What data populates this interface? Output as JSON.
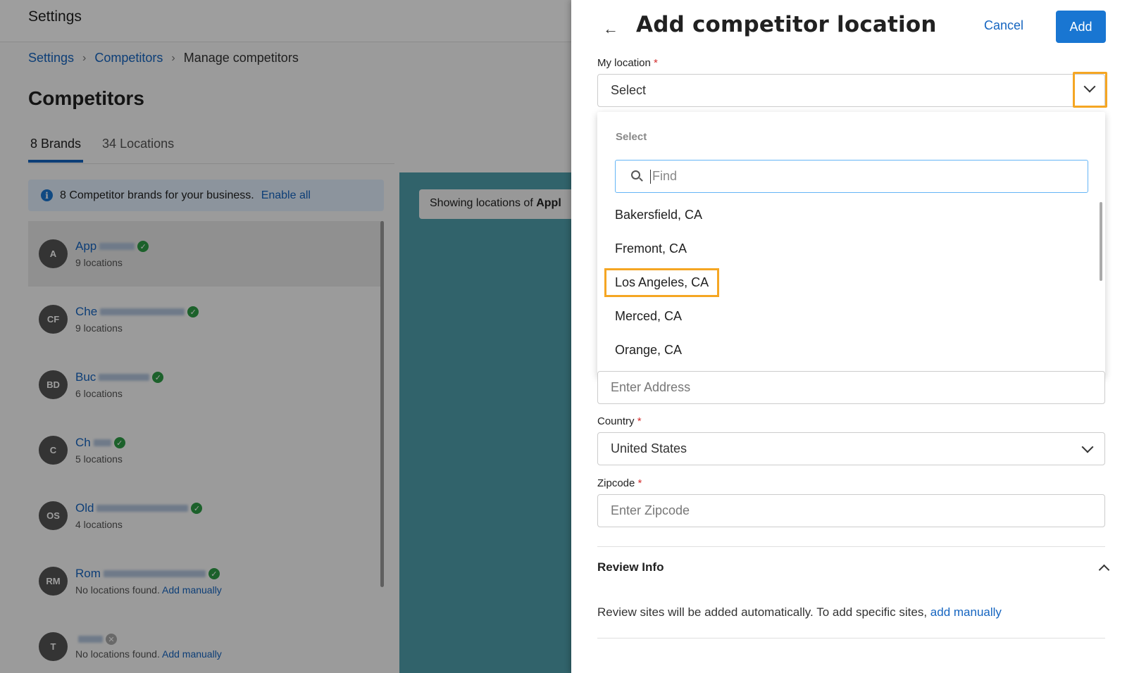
{
  "app": {
    "title": "Settings"
  },
  "breadcrumb": [
    {
      "label": "Settings"
    },
    {
      "label": "Competitors"
    },
    {
      "label": "Manage competitors"
    }
  ],
  "page": {
    "title": "Competitors"
  },
  "tabs": [
    {
      "label": "8 Brands"
    },
    {
      "label": "34 Locations"
    }
  ],
  "banner": {
    "text": "8 Competitor brands for your business.",
    "link": "Enable all"
  },
  "brands": [
    {
      "initials": "A",
      "name": "App",
      "sub": "9 locations",
      "verified": true
    },
    {
      "initials": "CF",
      "name": "Che",
      "sub": "9 locations",
      "verified": true
    },
    {
      "initials": "BD",
      "name": "Buc",
      "sub": "6 locations",
      "verified": true
    },
    {
      "initials": "C",
      "name": "Ch",
      "sub": "5 locations",
      "verified": true
    },
    {
      "initials": "OS",
      "name": "Old",
      "sub": "4 locations",
      "verified": true
    },
    {
      "initials": "RM",
      "name": "Rom",
      "sub": "No locations found.",
      "sub_link": "Add manually",
      "verified": true
    },
    {
      "initials": "T",
      "name": "",
      "sub": "No locations found.",
      "sub_link": "Add manually",
      "verified": false
    }
  ],
  "map": {
    "chip_text": "Showing locations of",
    "chip_bold": "Appl"
  },
  "drawer": {
    "title": "Add competitor location",
    "cancel_label": "Cancel",
    "add_label": "Add",
    "my_location": {
      "label": "My location",
      "required": "*",
      "value": "Select"
    },
    "dropdown": {
      "caption": "Select",
      "search_placeholder": "Find",
      "options": [
        "Bakersfield, CA",
        "Fremont, CA",
        "Los Angeles, CA",
        "Merced, CA",
        "Orange, CA"
      ]
    },
    "address": {
      "placeholder": "Enter Address"
    },
    "country": {
      "label": "Country",
      "required": "*",
      "value": "United States"
    },
    "zipcode": {
      "label": "Zipcode",
      "required": "*",
      "placeholder": "Enter Zipcode"
    },
    "review": {
      "title": "Review Info",
      "text": "Review sites will be added automatically. To add specific sites,",
      "link": "add manually"
    }
  },
  "colors": {
    "accent": "#1976d2",
    "highlight": "#f5a623",
    "verified": "#2e9d46",
    "required": "#d32f2f"
  }
}
